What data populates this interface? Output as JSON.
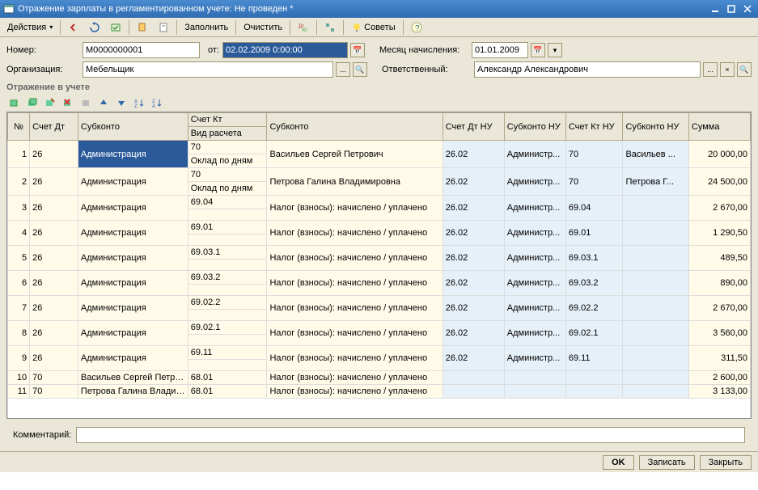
{
  "window": {
    "title": "Отражение зарплаты в регламентированном учете: Не проведен *"
  },
  "toolbar": {
    "actions": "Действия",
    "fill": "Заполнить",
    "clear": "Очистить",
    "tips": "Советы"
  },
  "form": {
    "number_label": "Номер:",
    "number": "М0000000001",
    "from_label": "от:",
    "from": "02.02.2009 0:00:00",
    "month_label": "Месяц начисления:",
    "month": "01.01.2009",
    "org_label": "Организация:",
    "org": "Мебельщик",
    "resp_label": "Ответственный:",
    "resp": "Александр Александрович"
  },
  "section_title": "Отражение в учете",
  "grid": {
    "headers": {
      "n": "№",
      "dt": "Счет Дт",
      "sub1": "Субконто",
      "kt": "Счет Кт",
      "calc": "Вид расчета",
      "sub2": "Субконто",
      "dtnu": "Счет Дт НУ",
      "subnu1": "Субконто НУ",
      "ktnu": "Счет Кт НУ",
      "subnu2": "Субконто НУ",
      "sum": "Сумма"
    },
    "rows": [
      {
        "n": "1",
        "dt": "26",
        "sub1": "Администрация",
        "kt": "70",
        "calc": "Оклад по дням",
        "sub2": "Васильев Сергей Петрович",
        "dtnu": "26.02",
        "subnu1": "Администр...",
        "ktnu": "70",
        "subnu2": "Васильев ...",
        "sum": "20 000,00",
        "extra": true,
        "sel": true
      },
      {
        "n": "2",
        "dt": "26",
        "sub1": "Администрация",
        "kt": "70",
        "calc": "Оклад по дням",
        "sub2": "Петрова Галина Владимировна",
        "dtnu": "26.02",
        "subnu1": "Администр...",
        "ktnu": "70",
        "subnu2": "Петрова Г...",
        "sum": "24 500,00",
        "extra": true
      },
      {
        "n": "3",
        "dt": "26",
        "sub1": "Администрация",
        "kt": "69.04",
        "calc": "",
        "sub2": "Налог (взносы): начислено / уплачено",
        "dtnu": "26.02",
        "subnu1": "Администр...",
        "ktnu": "69.04",
        "subnu2": "",
        "sum": "2 670,00",
        "extra": true
      },
      {
        "n": "4",
        "dt": "26",
        "sub1": "Администрация",
        "kt": "69.01",
        "calc": "",
        "sub2": "Налог (взносы): начислено / уплачено",
        "dtnu": "26.02",
        "subnu1": "Администр...",
        "ktnu": "69.01",
        "subnu2": "",
        "sum": "1 290,50",
        "extra": true
      },
      {
        "n": "5",
        "dt": "26",
        "sub1": "Администрация",
        "kt": "69.03.1",
        "calc": "",
        "sub2": "Налог (взносы): начислено / уплачено",
        "dtnu": "26.02",
        "subnu1": "Администр...",
        "ktnu": "69.03.1",
        "subnu2": "",
        "sum": "489,50",
        "extra": true
      },
      {
        "n": "6",
        "dt": "26",
        "sub1": "Администрация",
        "kt": "69.03.2",
        "calc": "",
        "sub2": "Налог (взносы): начислено / уплачено",
        "dtnu": "26.02",
        "subnu1": "Администр...",
        "ktnu": "69.03.2",
        "subnu2": "",
        "sum": "890,00",
        "extra": true
      },
      {
        "n": "7",
        "dt": "26",
        "sub1": "Администрация",
        "kt": "69.02.2",
        "calc": "",
        "sub2": "Налог (взносы): начислено / уплачено",
        "dtnu": "26.02",
        "subnu1": "Администр...",
        "ktnu": "69.02.2",
        "subnu2": "",
        "sum": "2 670,00",
        "extra": true
      },
      {
        "n": "8",
        "dt": "26",
        "sub1": "Администрация",
        "kt": "69.02.1",
        "calc": "",
        "sub2": "Налог (взносы): начислено / уплачено",
        "dtnu": "26.02",
        "subnu1": "Администр...",
        "ktnu": "69.02.1",
        "subnu2": "",
        "sum": "3 560,00",
        "extra": true
      },
      {
        "n": "9",
        "dt": "26",
        "sub1": "Администрация",
        "kt": "69.11",
        "calc": "",
        "sub2": "Налог (взносы): начислено / уплачено",
        "dtnu": "26.02",
        "subnu1": "Администр...",
        "ktnu": "69.11",
        "subnu2": "",
        "sum": "311,50",
        "extra": true
      },
      {
        "n": "10",
        "dt": "70",
        "sub1": "Васильев Сергей Петров...",
        "kt": "68.01",
        "calc": "",
        "sub2": "Налог (взносы): начислено / уплачено",
        "dtnu": "",
        "subnu1": "",
        "ktnu": "",
        "subnu2": "",
        "sum": "2 600,00",
        "extra": false
      },
      {
        "n": "11",
        "dt": "70",
        "sub1": "Петрова Галина Владим...",
        "kt": "68.01",
        "calc": "",
        "sub2": "Налог (взносы): начислено / уплачено",
        "dtnu": "",
        "subnu1": "",
        "ktnu": "",
        "subnu2": "",
        "sum": "3 133,00",
        "extra": false
      }
    ]
  },
  "comment_label": "Комментарий:",
  "comment": "",
  "footer": {
    "ok": "OK",
    "save": "Записать",
    "close": "Закрыть"
  }
}
